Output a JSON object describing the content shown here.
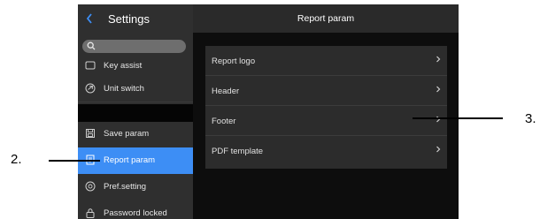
{
  "sidebar": {
    "title": "Settings",
    "search_placeholder": "",
    "items": [
      {
        "label": "Key assist",
        "icon": "keyboard-icon"
      },
      {
        "label": "Unit switch",
        "icon": "unit-switch-icon"
      },
      {
        "label": "Save param",
        "icon": "save-icon"
      },
      {
        "label": "Report param",
        "icon": "report-icon",
        "active": true
      },
      {
        "label": "Pref.setting",
        "icon": "preference-icon"
      },
      {
        "label": "Password locked",
        "icon": "lock-icon"
      }
    ]
  },
  "main": {
    "title": "Report param",
    "rows": [
      {
        "label": "Report logo"
      },
      {
        "label": "Header"
      },
      {
        "label": "Footer"
      },
      {
        "label": "PDF template"
      }
    ]
  },
  "annotations": {
    "left_label": "2.",
    "right_label": "3."
  },
  "colors": {
    "accent": "#3d8ef5",
    "sidebar_bg": "#2f2f2f",
    "panel_bg": "#0d0d0d",
    "list_bg": "#2c2c2c"
  }
}
